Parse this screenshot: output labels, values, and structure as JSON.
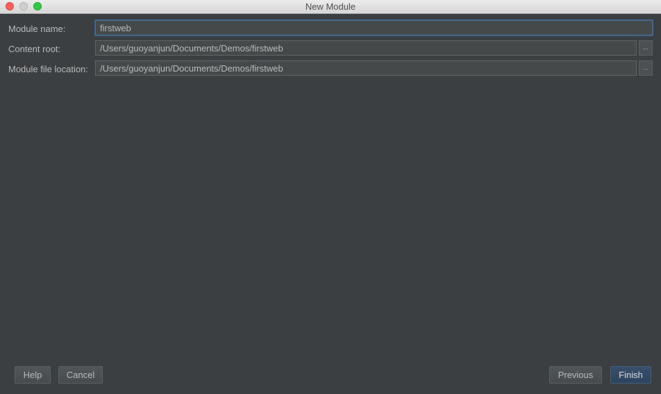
{
  "window": {
    "title": "New Module"
  },
  "form": {
    "module_name": {
      "label": "Module name:",
      "value": "firstweb"
    },
    "content_root": {
      "label": "Content root:",
      "value": "/Users/guoyanjun/Documents/Demos/firstweb",
      "browse_label": "..."
    },
    "module_file_location": {
      "label": "Module file location:",
      "value": "/Users/guoyanjun/Documents/Demos/firstweb",
      "browse_label": "..."
    }
  },
  "buttons": {
    "help": "Help",
    "cancel": "Cancel",
    "previous": "Previous",
    "finish": "Finish"
  },
  "colors": {
    "background": "#3c3f41",
    "field_background": "#45494a",
    "focus_border": "#466d94",
    "primary_button": "#365880",
    "text": "#bbbbbb"
  }
}
